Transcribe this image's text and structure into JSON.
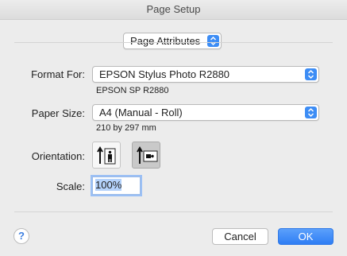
{
  "window": {
    "title": "Page Setup"
  },
  "settings_popup": {
    "value": "Page Attributes"
  },
  "format_for": {
    "label": "Format For:",
    "value": "EPSON Stylus Photo R2880",
    "detail": "EPSON SP R2880"
  },
  "paper_size": {
    "label": "Paper Size:",
    "value": "A4 (Manual - Roll)",
    "detail": "210 by 297 mm"
  },
  "orientation": {
    "label": "Orientation:",
    "options": [
      "portrait",
      "landscape"
    ],
    "selected": "landscape"
  },
  "scale": {
    "label": "Scale:",
    "value": "100%"
  },
  "buttons": {
    "help": "?",
    "cancel": "Cancel",
    "ok": "OK"
  },
  "colors": {
    "accent": "#3d8df5",
    "background": "#ececec"
  },
  "icons": {
    "popup_arrows": "up-down-chevron-icon",
    "portrait": "portrait-orientation-icon",
    "landscape": "landscape-orientation-icon"
  }
}
